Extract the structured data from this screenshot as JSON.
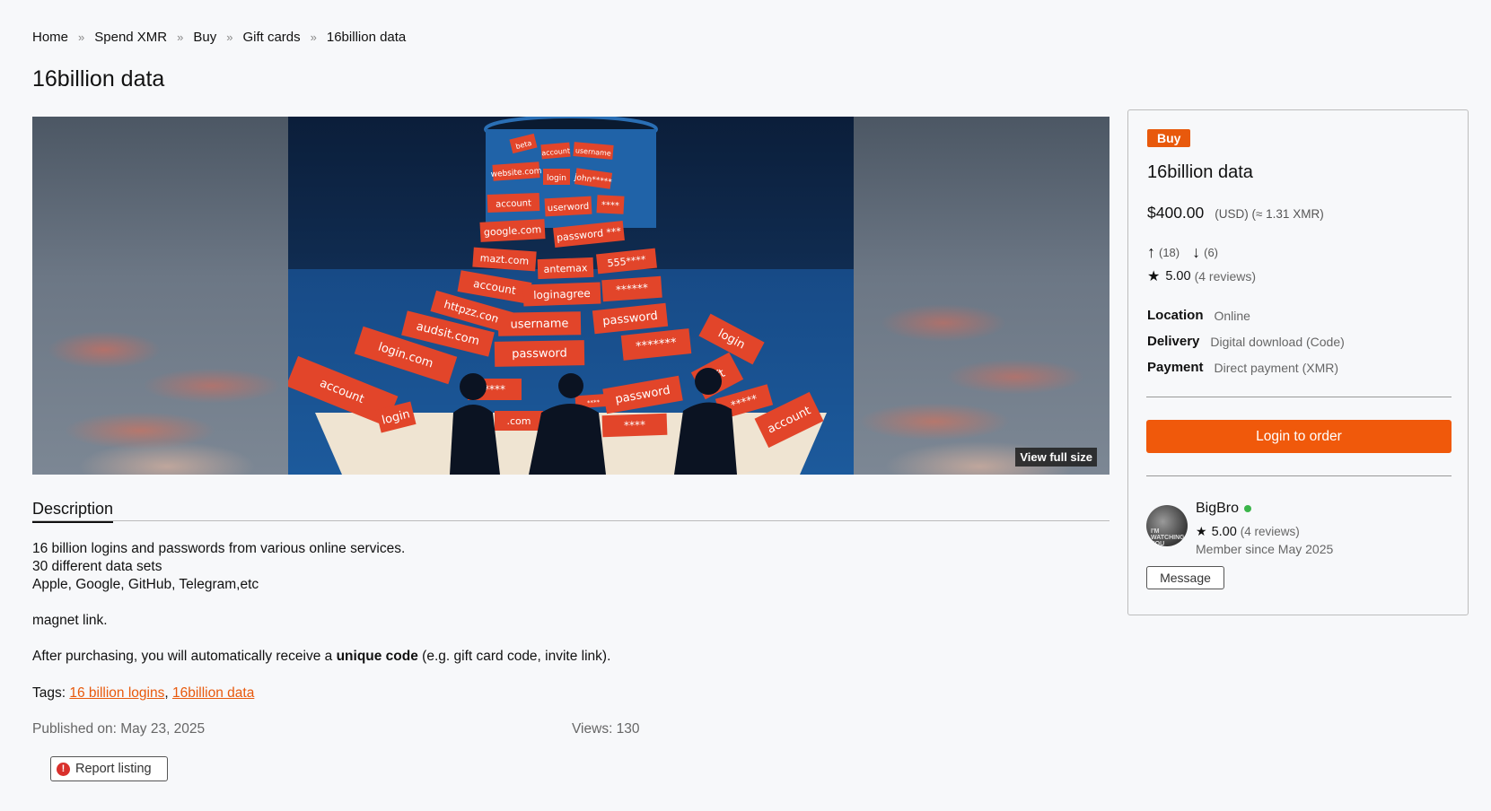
{
  "breadcrumb": [
    "Home",
    "Spend XMR",
    "Buy",
    "Gift cards",
    "16billion data"
  ],
  "breadcrumb_sep": "»",
  "page_title": "16billion data",
  "image": {
    "view_full_label": "View full size"
  },
  "image_tiles": [
    "beta",
    "account",
    "username",
    "website.com",
    "login",
    "john*****",
    "account",
    "userword",
    "****",
    "google.com",
    "password ***",
    "mazt.com",
    "antemax",
    "555****",
    "account",
    "loginagree",
    "******",
    "httpzz.com",
    "username",
    "password",
    "audsit.com",
    "password",
    "*******",
    "login",
    "login.com",
    "****",
    "password",
    "oft",
    "account",
    ".com",
    "****",
    "account",
    "login",
    "*****",
    "****"
  ],
  "description": {
    "tab_label": "Description",
    "line1": "16 billion logins and passwords from various online services.",
    "line2": "30 different data sets",
    "line3": "Apple, Google, GitHub, Telegram,etc",
    "line4": "magnet link.",
    "line5_prefix": "After purchasing, you will automatically receive a ",
    "line5_bold": "unique code",
    "line5_suffix": " (e.g. gift card code, invite link).",
    "tags_label": "Tags: ",
    "tags": [
      "16 billion logins",
      "16billion data"
    ],
    "tag_sep": ", "
  },
  "meta": {
    "published": "Published on: May 23, 2025",
    "views": "Views: 130"
  },
  "report_label": "Report listing",
  "card": {
    "badge": "Buy",
    "title": "16billion data",
    "price": "$400.00",
    "price_sub": "(USD) (≈ 1.31 XMR)",
    "up_count": "(18)",
    "down_count": "(6)",
    "rating": "5.00",
    "reviews": "(4 reviews)",
    "info": [
      {
        "label": "Location",
        "value": "Online"
      },
      {
        "label": "Delivery",
        "value": "Digital download (Code)"
      },
      {
        "label": "Payment",
        "value": "Direct payment (XMR)"
      }
    ],
    "login_label": "Login to order",
    "seller": {
      "name": "BigBro",
      "rating": "5.00",
      "reviews": "(4 reviews)",
      "member_since": "Member since May 2025",
      "message_label": "Message",
      "avatar_text": "I'M WATCHING YOU"
    }
  },
  "colors": {
    "accent": "#f0590b",
    "online": "#3bb54a",
    "report_icon": "#d9302c"
  }
}
